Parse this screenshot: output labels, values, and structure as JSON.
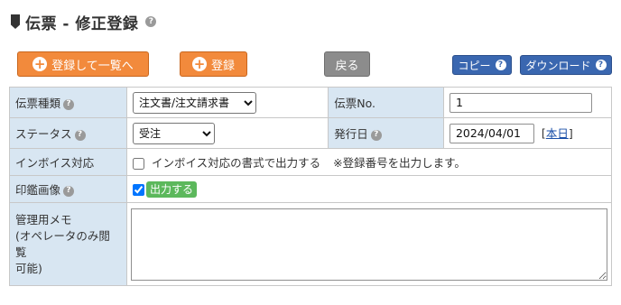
{
  "page": {
    "title": "伝票 - 修正登録",
    "help": "?"
  },
  "toolbar": {
    "register_back_label": "登録して一覧へ",
    "register_label": "登録",
    "back_label": "戻る",
    "copy_label": "コピー",
    "download_label": "ダウンロード",
    "plus": "+",
    "help": "?"
  },
  "form": {
    "slip_type": {
      "label": "伝票種類",
      "help": "?",
      "selected": "注文書/注文請求書"
    },
    "slip_no": {
      "label": "伝票No.",
      "value": "1"
    },
    "status": {
      "label": "ステータス",
      "help": "?",
      "selected": "受注"
    },
    "issue_date": {
      "label": "発行日",
      "help": "?",
      "value": "2024/04/01",
      "today_open": "[",
      "today_link": "本日",
      "today_close": "]"
    },
    "invoice": {
      "label": "インボイス対応",
      "checkbox_label": "インボイス対応の書式で出力する",
      "note": "※登録番号を出力します。",
      "checked": false
    },
    "seal": {
      "label": "印鑑画像",
      "help": "?",
      "checkbox_label": "出力する",
      "checked": true
    },
    "memo": {
      "label_line1": "管理用メモ",
      "label_line2": "(オペレータのみ閲覧",
      "label_line3": "可能)",
      "value": ""
    }
  },
  "colors": {
    "label_bg": "#d8e6f2",
    "orange": "#f28a3c",
    "blue": "#3a67b0",
    "gray": "#8c8c8c",
    "green": "#5cb85c"
  }
}
